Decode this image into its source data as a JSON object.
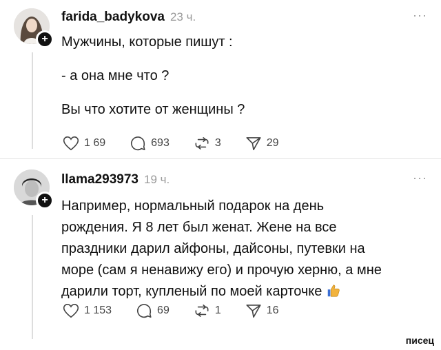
{
  "posts": [
    {
      "username": "farida_badykova",
      "time": "23 ч.",
      "more": "···",
      "lines": [
        "Мужчины, которые пишут :",
        "- а она мне что ?",
        "Вы что хотите от женщины ?"
      ],
      "likes": "1 69",
      "comments": "693",
      "reposts": "3",
      "shares": "29"
    },
    {
      "username": "llama293973",
      "time": "19 ч.",
      "more": "···",
      "lines": [
        "Например, нормальный подарок на день",
        "рождения. Я 8 лет был женат. Жене на все",
        "праздники дарил айфоны, дайсоны, путевки на",
        "море (сам я ненавижу его) и прочую херню, а мне",
        "дарили торт, купленый по моей карточке"
      ],
      "emoji": "thumbs-up-icon",
      "likes": "1 153",
      "comments": "69",
      "reposts": "1",
      "shares": "16"
    }
  ],
  "watermark": "писец",
  "colors": {
    "accent": "#111111",
    "muted": "#9a9a9a",
    "thumb": "#f2b33d"
  }
}
